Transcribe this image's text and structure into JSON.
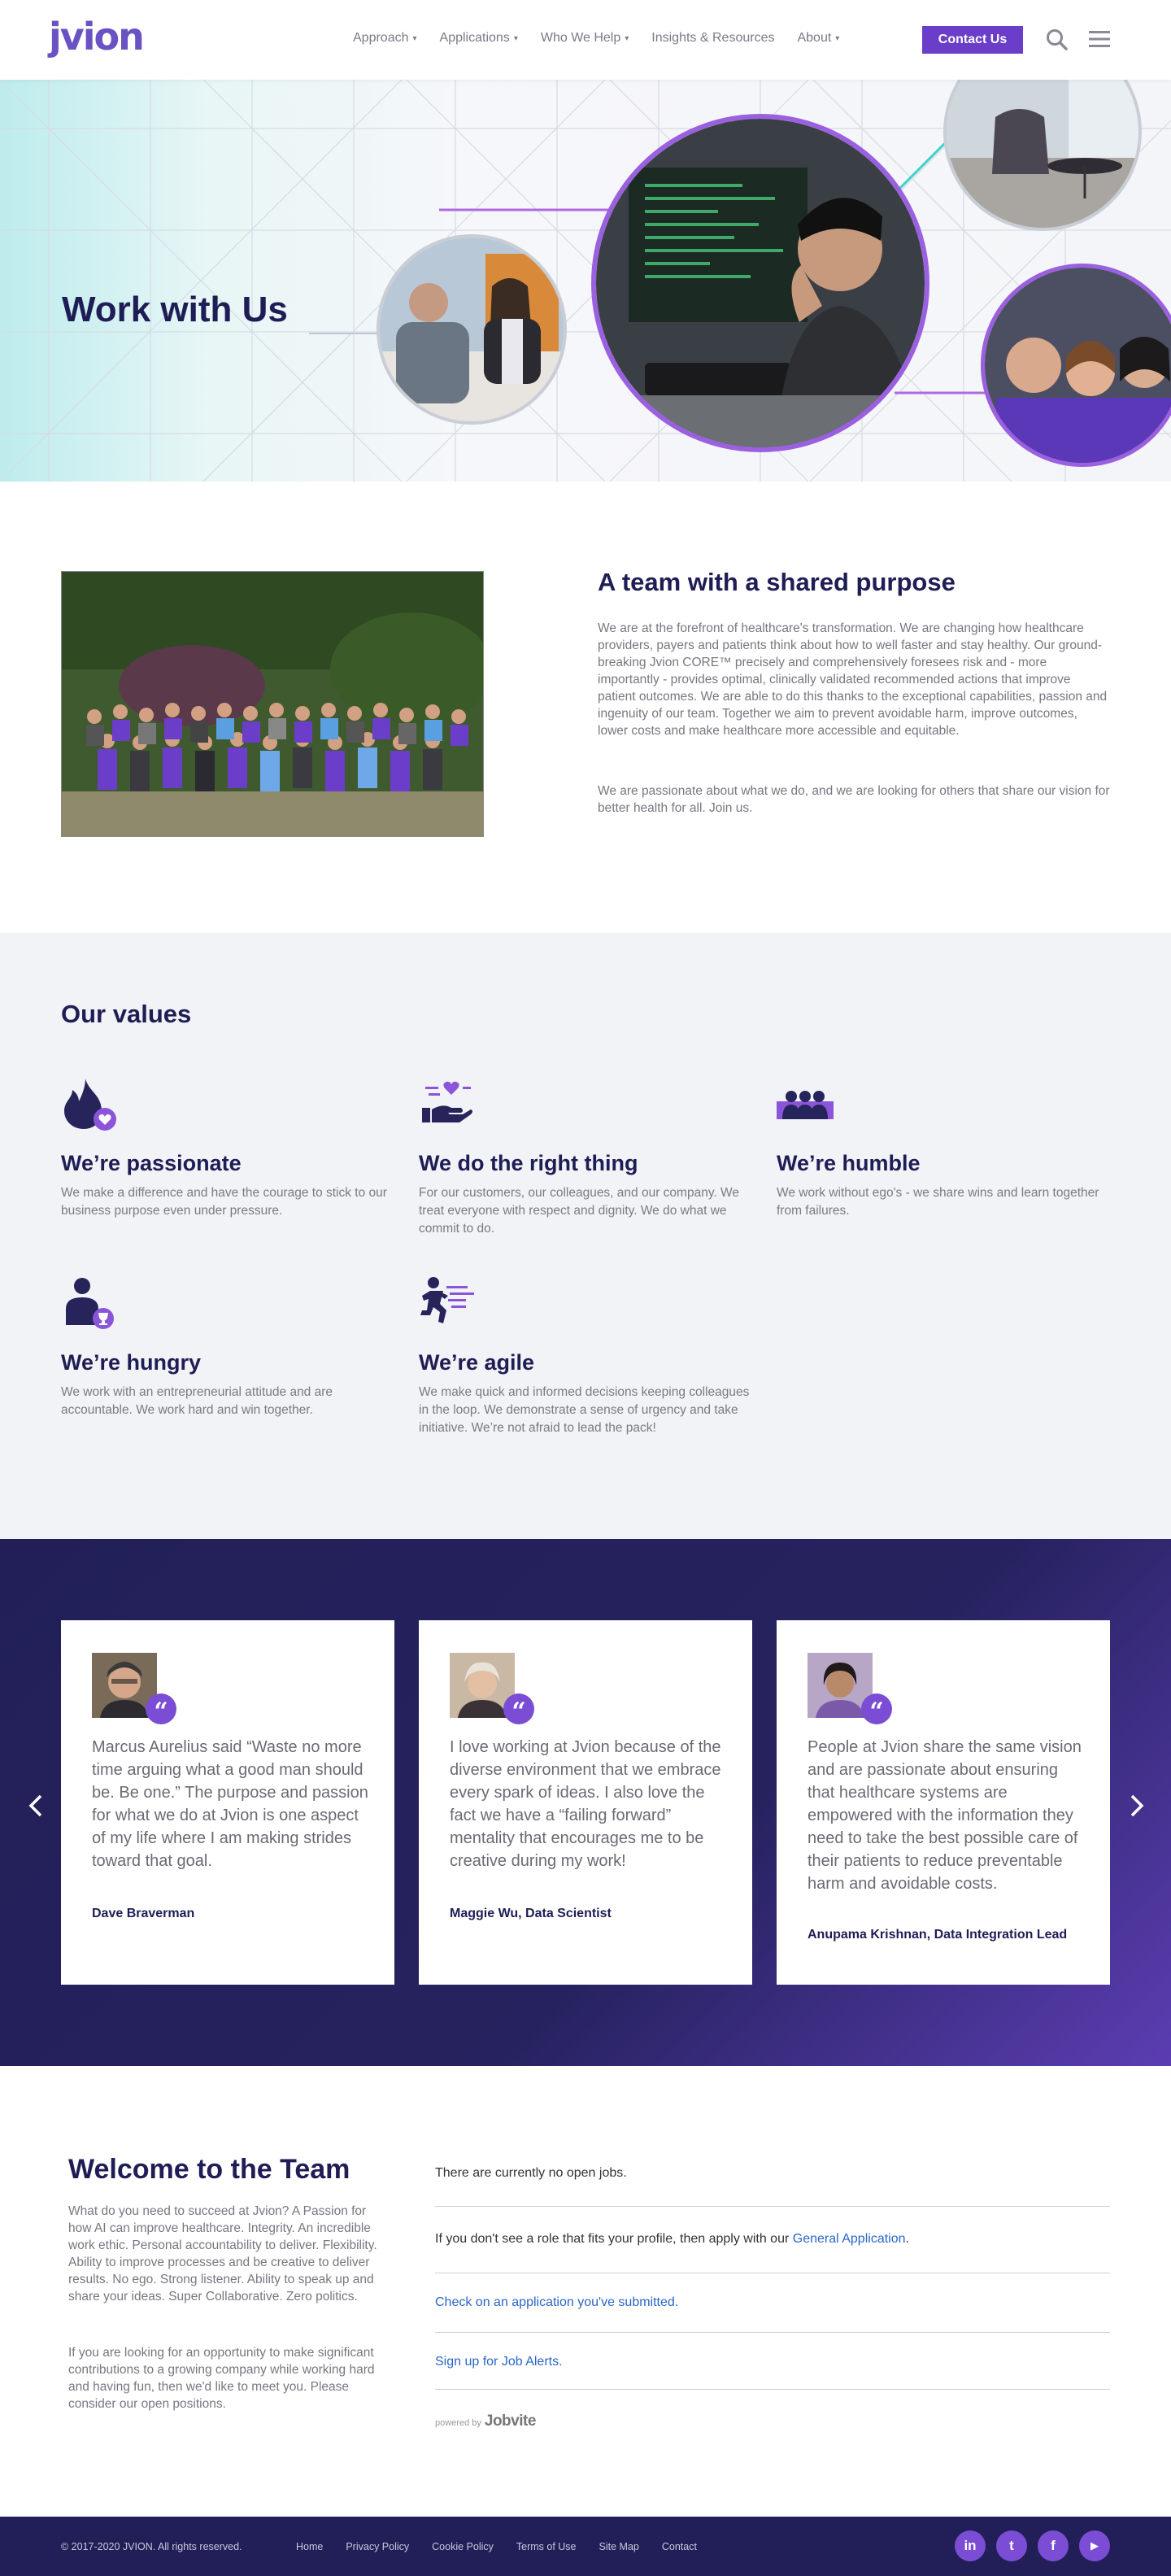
{
  "header": {
    "logo": "jvion",
    "nav": [
      {
        "label": "Approach",
        "dropdown": true
      },
      {
        "label": "Applications",
        "dropdown": true
      },
      {
        "label": "Who We Help",
        "dropdown": true
      },
      {
        "label": "Insights & Resources",
        "dropdown": false
      },
      {
        "label": "About",
        "dropdown": true
      }
    ],
    "contact_label": "Contact Us"
  },
  "hero": {
    "title": "Work with Us"
  },
  "team": {
    "heading": "A team with a shared purpose",
    "p1": "We are at the forefront of healthcare's transformation. We are changing how healthcare providers, payers and patients think about how to well faster and stay healthy.  Our ground-breaking Jvion CORE™ precisely and comprehensively foresees risk and - more importantly - provides optimal, clinically validated recommended actions that improve patient outcomes.  We are able to do this thanks to the exceptional capabilities, passion and ingenuity of our team.  Together we aim to prevent avoidable harm, improve outcomes, lower costs and make healthcare more accessible and equitable.",
    "p2": "We are passionate about what we do, and we are looking for others that share our vision for better health for all. Join us."
  },
  "values": {
    "title": "Our values",
    "items": [
      {
        "icon": "flame-heart-icon",
        "title": "We’re passionate",
        "text": "We make a difference and have the courage to stick to our business purpose even under pressure."
      },
      {
        "icon": "hand-heart-icon",
        "title": "We do the right thing",
        "text": "For our customers, our colleagues, and our company.  We treat everyone with respect and dignity.  We do what we commit to do."
      },
      {
        "icon": "team-icon",
        "title": "We’re humble",
        "text": "We work without ego's - we share wins and learn together from failures."
      },
      {
        "icon": "person-trophy-icon",
        "title": "We’re hungry",
        "text": "We work with an entrepreneurial attitude and are accountable.  We work hard and win together."
      },
      {
        "icon": "running-person-icon",
        "title": "We’re agile",
        "text": "We make quick and informed decisions keeping colleagues in the loop.  We demonstrate a sense of urgency and take initiative.  We’re not afraid to lead the pack!"
      }
    ]
  },
  "testimonials": [
    {
      "quote": "Marcus Aurelius said “Waste no more time arguing what a good man should be.  Be one.”  The purpose and passion for what we do at Jvion is one aspect of my life where I am making strides toward that goal.",
      "name": "Dave Braverman"
    },
    {
      "quote": "I love working at Jvion because of the diverse environment that we embrace every spark of ideas. I also love the fact we have a “failing forward” mentality that encourages me to be creative during my work!",
      "name": "Maggie Wu, Data Scientist"
    },
    {
      "quote": "People at Jvion share the same vision and are passionate about ensuring that healthcare systems are empowered with the information they need to take the best possible care of their patients to reduce preventable harm and avoidable costs.",
      "name": "Anupama Krishnan, Data Integration Lead"
    }
  ],
  "welcome": {
    "title": "Welcome to the Team",
    "p1": "What do you need to succeed at Jvion? A Passion for how AI can improve healthcare.  Integrity.  An incredible work ethic.  Personal accountability to deliver.  Flexibility.  Ability to improve processes and be creative to deliver results.  No ego.  Strong listener.  Ability to speak up and share your ideas.  Super Collaborative.  Zero politics.",
    "p2": "If you are looking for an opportunity to make significant contributions to a growing company while working hard and having fun, then we'd like to meet you. Please consider our open positions."
  },
  "jobs": {
    "no_jobs": "There are currently no open jobs.",
    "profile_prefix": "If you don't see a role that fits your profile, then apply with our ",
    "general_application": "General Application",
    "profile_suffix": ".",
    "check_application": "Check on an application you've submitted.",
    "job_alerts": "Sign up for Job Alerts.",
    "powered_by": "powered by",
    "powered_brand": "Jobvite"
  },
  "footer": {
    "copyright": "© 2017-2020 JVION. All rights reserved.",
    "links": [
      "Home",
      "Privacy Policy",
      "Cookie Policy",
      "Terms of Use",
      "Site Map",
      "Contact"
    ],
    "social": [
      {
        "icon": "linkedin-icon",
        "glyph": "in"
      },
      {
        "icon": "twitter-icon",
        "glyph": "t"
      },
      {
        "icon": "facebook-icon",
        "glyph": "f"
      },
      {
        "icon": "youtube-icon",
        "glyph": "▶"
      }
    ]
  },
  "colors": {
    "brand_purple": "#6a3ec8",
    "navy": "#1f1d55",
    "accent_teal": "#3fd0cc"
  }
}
